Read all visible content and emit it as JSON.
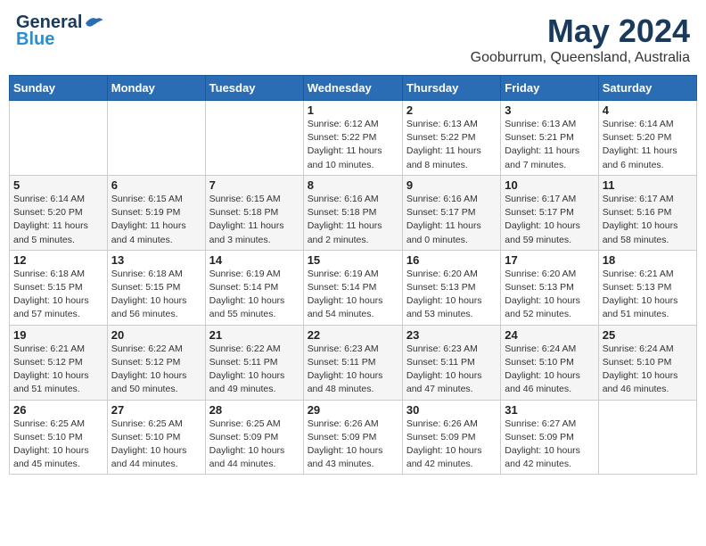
{
  "header": {
    "logo_general": "General",
    "logo_blue": "Blue",
    "month": "May 2024",
    "location": "Gooburrum, Queensland, Australia"
  },
  "weekdays": [
    "Sunday",
    "Monday",
    "Tuesday",
    "Wednesday",
    "Thursday",
    "Friday",
    "Saturday"
  ],
  "weeks": [
    [
      {
        "day": "",
        "info": ""
      },
      {
        "day": "",
        "info": ""
      },
      {
        "day": "",
        "info": ""
      },
      {
        "day": "1",
        "info": "Sunrise: 6:12 AM\nSunset: 5:22 PM\nDaylight: 11 hours\nand 10 minutes."
      },
      {
        "day": "2",
        "info": "Sunrise: 6:13 AM\nSunset: 5:22 PM\nDaylight: 11 hours\nand 8 minutes."
      },
      {
        "day": "3",
        "info": "Sunrise: 6:13 AM\nSunset: 5:21 PM\nDaylight: 11 hours\nand 7 minutes."
      },
      {
        "day": "4",
        "info": "Sunrise: 6:14 AM\nSunset: 5:20 PM\nDaylight: 11 hours\nand 6 minutes."
      }
    ],
    [
      {
        "day": "5",
        "info": "Sunrise: 6:14 AM\nSunset: 5:20 PM\nDaylight: 11 hours\nand 5 minutes."
      },
      {
        "day": "6",
        "info": "Sunrise: 6:15 AM\nSunset: 5:19 PM\nDaylight: 11 hours\nand 4 minutes."
      },
      {
        "day": "7",
        "info": "Sunrise: 6:15 AM\nSunset: 5:18 PM\nDaylight: 11 hours\nand 3 minutes."
      },
      {
        "day": "8",
        "info": "Sunrise: 6:16 AM\nSunset: 5:18 PM\nDaylight: 11 hours\nand 2 minutes."
      },
      {
        "day": "9",
        "info": "Sunrise: 6:16 AM\nSunset: 5:17 PM\nDaylight: 11 hours\nand 0 minutes."
      },
      {
        "day": "10",
        "info": "Sunrise: 6:17 AM\nSunset: 5:17 PM\nDaylight: 10 hours\nand 59 minutes."
      },
      {
        "day": "11",
        "info": "Sunrise: 6:17 AM\nSunset: 5:16 PM\nDaylight: 10 hours\nand 58 minutes."
      }
    ],
    [
      {
        "day": "12",
        "info": "Sunrise: 6:18 AM\nSunset: 5:15 PM\nDaylight: 10 hours\nand 57 minutes."
      },
      {
        "day": "13",
        "info": "Sunrise: 6:18 AM\nSunset: 5:15 PM\nDaylight: 10 hours\nand 56 minutes."
      },
      {
        "day": "14",
        "info": "Sunrise: 6:19 AM\nSunset: 5:14 PM\nDaylight: 10 hours\nand 55 minutes."
      },
      {
        "day": "15",
        "info": "Sunrise: 6:19 AM\nSunset: 5:14 PM\nDaylight: 10 hours\nand 54 minutes."
      },
      {
        "day": "16",
        "info": "Sunrise: 6:20 AM\nSunset: 5:13 PM\nDaylight: 10 hours\nand 53 minutes."
      },
      {
        "day": "17",
        "info": "Sunrise: 6:20 AM\nSunset: 5:13 PM\nDaylight: 10 hours\nand 52 minutes."
      },
      {
        "day": "18",
        "info": "Sunrise: 6:21 AM\nSunset: 5:13 PM\nDaylight: 10 hours\nand 51 minutes."
      }
    ],
    [
      {
        "day": "19",
        "info": "Sunrise: 6:21 AM\nSunset: 5:12 PM\nDaylight: 10 hours\nand 51 minutes."
      },
      {
        "day": "20",
        "info": "Sunrise: 6:22 AM\nSunset: 5:12 PM\nDaylight: 10 hours\nand 50 minutes."
      },
      {
        "day": "21",
        "info": "Sunrise: 6:22 AM\nSunset: 5:11 PM\nDaylight: 10 hours\nand 49 minutes."
      },
      {
        "day": "22",
        "info": "Sunrise: 6:23 AM\nSunset: 5:11 PM\nDaylight: 10 hours\nand 48 minutes."
      },
      {
        "day": "23",
        "info": "Sunrise: 6:23 AM\nSunset: 5:11 PM\nDaylight: 10 hours\nand 47 minutes."
      },
      {
        "day": "24",
        "info": "Sunrise: 6:24 AM\nSunset: 5:10 PM\nDaylight: 10 hours\nand 46 minutes."
      },
      {
        "day": "25",
        "info": "Sunrise: 6:24 AM\nSunset: 5:10 PM\nDaylight: 10 hours\nand 46 minutes."
      }
    ],
    [
      {
        "day": "26",
        "info": "Sunrise: 6:25 AM\nSunset: 5:10 PM\nDaylight: 10 hours\nand 45 minutes."
      },
      {
        "day": "27",
        "info": "Sunrise: 6:25 AM\nSunset: 5:10 PM\nDaylight: 10 hours\nand 44 minutes."
      },
      {
        "day": "28",
        "info": "Sunrise: 6:25 AM\nSunset: 5:09 PM\nDaylight: 10 hours\nand 44 minutes."
      },
      {
        "day": "29",
        "info": "Sunrise: 6:26 AM\nSunset: 5:09 PM\nDaylight: 10 hours\nand 43 minutes."
      },
      {
        "day": "30",
        "info": "Sunrise: 6:26 AM\nSunset: 5:09 PM\nDaylight: 10 hours\nand 42 minutes."
      },
      {
        "day": "31",
        "info": "Sunrise: 6:27 AM\nSunset: 5:09 PM\nDaylight: 10 hours\nand 42 minutes."
      },
      {
        "day": "",
        "info": ""
      }
    ]
  ]
}
